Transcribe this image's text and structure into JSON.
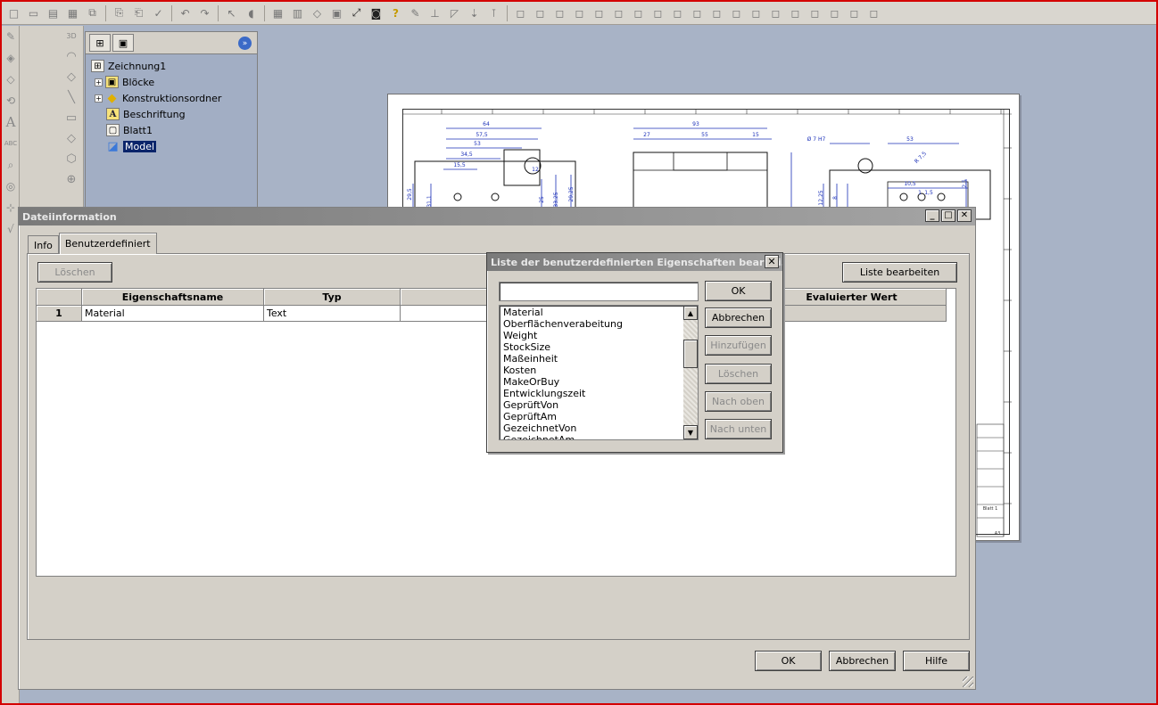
{
  "toolbar": {
    "icons": [
      "new-icon",
      "open-icon",
      "save-icon",
      "print-preview-icon",
      "publish-icon",
      "cut-icon",
      "copy-icon",
      "spellcheck-icon",
      "undo-icon",
      "redo-icon",
      "select-icon",
      "shape-icon",
      "grid-icon",
      "layers-icon",
      "view-cube-icon",
      "view-icon",
      "zoom-fit-icon",
      "camera-icon",
      "help-icon",
      "tool-icon",
      "measure-icon",
      "dimension-icon",
      "arrow-down-icon",
      "pin-icon",
      "box-1-icon",
      "box-2-icon",
      "box-3-icon",
      "box-4-icon",
      "box-5-icon",
      "box-6-icon",
      "box-7-icon",
      "box-8-icon",
      "box-9-icon",
      "box-10-icon",
      "box-11-icon",
      "box-12-icon",
      "box-13-icon",
      "box-14-icon",
      "box-15-icon",
      "box-16-icon",
      "box-17-icon",
      "box-18-icon",
      "box-19-icon"
    ]
  },
  "left_tools": {
    "strip1": [
      "sketch-icon",
      "curve-icon",
      "dimension-icon",
      "arc-icon",
      "text-tool-icon",
      "spell-icon",
      "search-tool-icon",
      "balloon-icon",
      "tolerance-icon",
      "symbol-icon"
    ],
    "strip1_text": {
      "text_tool": "A",
      "spell": "ABC"
    },
    "strip2": [
      "3d-line-icon",
      "3d-arc-icon",
      "measure-tool-icon",
      "line-tool-icon",
      "rectangle-tool-icon",
      "polygon-tool-icon",
      "hexagon-tool-icon",
      "circle-tool-icon"
    ],
    "strip2_text": {
      "label_3d": "3D"
    }
  },
  "browser": {
    "tree": [
      {
        "label": "Zeichnung1",
        "icon": "drawing-icon",
        "expander": false
      },
      {
        "label": "Blöcke",
        "icon": "blocks-icon",
        "expander": true
      },
      {
        "label": "Konstruktionsordner",
        "icon": "folder-icon",
        "expander": true
      },
      {
        "label": "Beschriftung",
        "icon": "annotation-icon",
        "expander": false
      },
      {
        "label": "Blatt1",
        "icon": "sheet-icon",
        "expander": false
      },
      {
        "label": "Model",
        "icon": "model-icon",
        "expander": false,
        "selected": true
      }
    ],
    "tree_glyph": {
      "plus": "+",
      "annotation": "A"
    }
  },
  "drawing": {
    "dims": [
      "64",
      "57,5",
      "53",
      "34,5",
      "15,5",
      "93",
      "27",
      "55",
      "15",
      "Ø 7 H7",
      "53",
      "R 7,5",
      "12",
      "29,5",
      "31,1",
      "25",
      "33,25",
      "29,25",
      "12,25",
      "8",
      "10,5",
      "1",
      "1,5",
      "2,5"
    ],
    "title_block": [
      "Blatt 1",
      "A3"
    ]
  },
  "dialog": {
    "title": "Dateiinformation",
    "window_buttons": {
      "minimize": "_",
      "maximize": "□",
      "close": "✕"
    },
    "tabs": [
      "Info",
      "Benutzerdefiniert"
    ],
    "active_tab": "Benutzerdefiniert",
    "delete_button": "Löschen",
    "edit_list_button": "Liste bearbeiten",
    "grid": {
      "headers": [
        "",
        "Eigenschaftsname",
        "Typ",
        "",
        "Evaluierter Wert"
      ],
      "rows": [
        {
          "num": "1",
          "name": "Material",
          "type": "Text",
          "value": "",
          "evaluated": ""
        }
      ]
    },
    "ok": "OK",
    "cancel": "Abbrechen",
    "help": "Hilfe"
  },
  "subdialog": {
    "title": "Liste der benutzerdefinierten Eigenschaften bearbei...",
    "close": "✕",
    "input_value": "",
    "items": [
      "Material",
      "Oberflächenverabeitung",
      "Weight",
      "StockSize",
      "Maßeinheit",
      "Kosten",
      "MakeOrBuy",
      "Entwicklungszeit",
      "GeprüftVon",
      "GeprüftAm",
      "GezeichnetVon",
      "GezeichnetAm"
    ],
    "scroll_up": "▲",
    "scroll_down": "▼",
    "buttons": {
      "ok": "OK",
      "cancel": "Abbrechen",
      "add": "Hinzufügen",
      "delete": "Löschen",
      "up": "Nach oben",
      "down": "Nach unten"
    }
  }
}
